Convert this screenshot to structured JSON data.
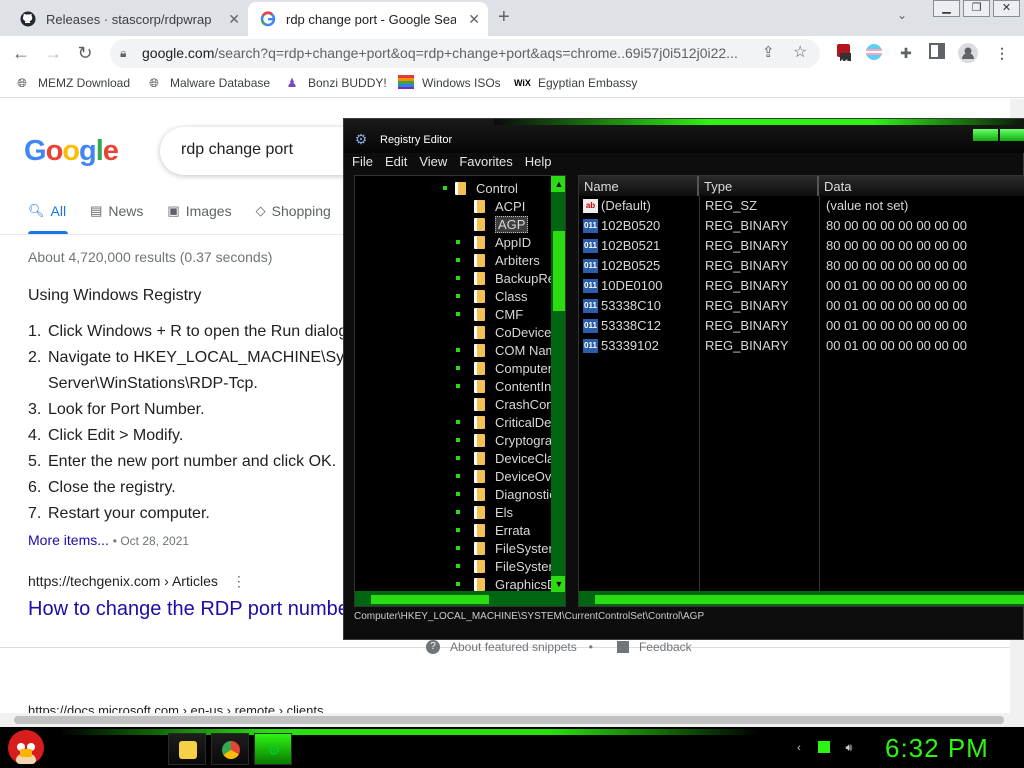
{
  "browser": {
    "tabs": [
      {
        "title": "Releases · stascorp/rdpwrap · Gi",
        "icon": "github-icon"
      },
      {
        "title": "rdp change port - Google Search",
        "icon": "google-icon"
      }
    ],
    "new_tab": "+",
    "tab_close": "✕",
    "address": {
      "host": "google.com",
      "path": "/search?q=rdp+change+port&oq=rdp+change+port&aqs=chrome..69i57j0i512j0i22..."
    },
    "extension_badge": "11",
    "bookmarks": [
      {
        "label": "MEMZ Download",
        "icon": "globe-icon"
      },
      {
        "label": "Malware Database",
        "icon": "globe-icon"
      },
      {
        "label": "Bonzi BUDDY!",
        "icon": "bonzi-icon"
      },
      {
        "label": "Windows ISOs",
        "icon": "windows-logo-icon"
      },
      {
        "label": "Egyptian Embassy",
        "icon": "wix-icon"
      }
    ]
  },
  "google": {
    "logo": "Google",
    "query": "rdp change port",
    "tabs": [
      {
        "label": "All",
        "icon": "search-icon"
      },
      {
        "label": "News",
        "icon": "news-icon"
      },
      {
        "label": "Images",
        "icon": "image-icon"
      },
      {
        "label": "Shopping",
        "icon": "tag-icon"
      }
    ],
    "stats": "About 4,720,000 results (0.37 seconds)",
    "snippet_title": "Using Windows Registry",
    "steps": [
      {
        "n": "1.",
        "text": "Click Windows + R to open the Run dialog"
      },
      {
        "n": "2.",
        "text": "Navigate to HKEY_LOCAL_MACHINE\\Sy",
        "cont": "Server\\WinStations\\RDP-Tcp."
      },
      {
        "n": "3.",
        "text": "Look for Port Number."
      },
      {
        "n": "4.",
        "text": "Click Edit > Modify."
      },
      {
        "n": "5.",
        "text": "Enter the new port number and click OK."
      },
      {
        "n": "6.",
        "text": "Close the registry."
      },
      {
        "n": "7.",
        "text": "Restart your computer."
      }
    ],
    "more_items": "More items...",
    "more_date": "Oct 28, 2021",
    "result_source": "https://techgenix.com › Articles",
    "result_title": "How to change the RDP port number",
    "about_snippets": "About featured snippets",
    "feedback": "Feedback",
    "next_source": "https://docs.microsoft.com › en-us › remote › clients"
  },
  "regedit": {
    "title": "Registry Editor",
    "menu": [
      "File",
      "Edit",
      "View",
      "Favorites",
      "Help"
    ],
    "tree": {
      "parent": "Control",
      "children": [
        "ACPI",
        "AGP",
        "AppID",
        "Arbiters",
        "BackupRe",
        "Class",
        "CMF",
        "CoDeviceI",
        "COM Nam",
        "ComputerI",
        "ContentInc",
        "CrashCont",
        "CriticalDev",
        "Cryptograp",
        "DeviceClas",
        "DeviceOve",
        "Diagnostic",
        "Els",
        "Errata",
        "FileSyster",
        "FileSyster",
        "GraphicsD"
      ],
      "selected": "AGP"
    },
    "columns": [
      "Name",
      "Type",
      "Data"
    ],
    "values": [
      {
        "name": "(Default)",
        "type": "REG_SZ",
        "data": "(value not set)",
        "icon": "ab"
      },
      {
        "name": "102B0520",
        "type": "REG_BINARY",
        "data": "80 00 00 00 00 00 00 00",
        "icon": "011"
      },
      {
        "name": "102B0521",
        "type": "REG_BINARY",
        "data": "80 00 00 00 00 00 00 00",
        "icon": "011"
      },
      {
        "name": "102B0525",
        "type": "REG_BINARY",
        "data": "80 00 00 00 00 00 00 00",
        "icon": "011"
      },
      {
        "name": "10DE0100",
        "type": "REG_BINARY",
        "data": "00 01 00 00 00 00 00 00",
        "icon": "011"
      },
      {
        "name": "53338C10",
        "type": "REG_BINARY",
        "data": "00 01 00 00 00 00 00 00",
        "icon": "011"
      },
      {
        "name": "53338C12",
        "type": "REG_BINARY",
        "data": "00 01 00 00 00 00 00 00",
        "icon": "011"
      },
      {
        "name": "53339102",
        "type": "REG_BINARY",
        "data": "00 01 00 00 00 00 00 00",
        "icon": "011"
      }
    ],
    "status": "Computer\\HKEY_LOCAL_MACHINE\\SYSTEM\\CurrentControlSet\\Control\\AGP"
  },
  "taskbar": {
    "clock": "6:32 PM",
    "accent": "#2cf513"
  }
}
